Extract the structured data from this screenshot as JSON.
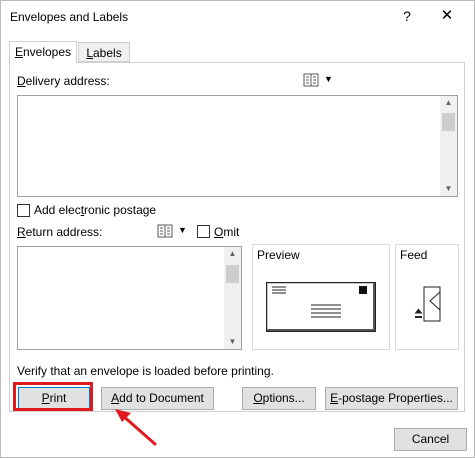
{
  "window": {
    "title": "Envelopes and Labels",
    "help_glyph": "?",
    "close_glyph": "✕"
  },
  "tabs": [
    {
      "label": "Envelopes",
      "mnemonic": "E",
      "rest": "nvelopes",
      "active": true
    },
    {
      "label": "Labels",
      "mnemonic": "L",
      "rest": "abels",
      "active": false
    }
  ],
  "delivery": {
    "label_mnemonic": "D",
    "label_rest": "elivery address:",
    "value": ""
  },
  "postage": {
    "label_pre": "Add elec",
    "label_mnemonic": "t",
    "label_post": "ronic postage",
    "checked": false
  },
  "return_address": {
    "label_mnemonic": "R",
    "label_rest": "eturn address:",
    "value": ""
  },
  "omit": {
    "label_mnemonic": "O",
    "label_rest": "mit",
    "checked": false
  },
  "preview": {
    "label": "Preview"
  },
  "feed": {
    "label": "Feed"
  },
  "verify_text": "Verify that an envelope is loaded before printing.",
  "buttons": {
    "print_mnemonic": "P",
    "print_rest": "rint",
    "add_mnemonic": "A",
    "add_rest": "dd to Document",
    "options_mnemonic": "O",
    "options_rest": "ptions...",
    "epostage_mnemonic": "E",
    "epostage_rest": "-postage Properties...",
    "cancel": "Cancel"
  },
  "colors": {
    "highlight": "#e0191e",
    "default_button_border": "#0078d7"
  }
}
